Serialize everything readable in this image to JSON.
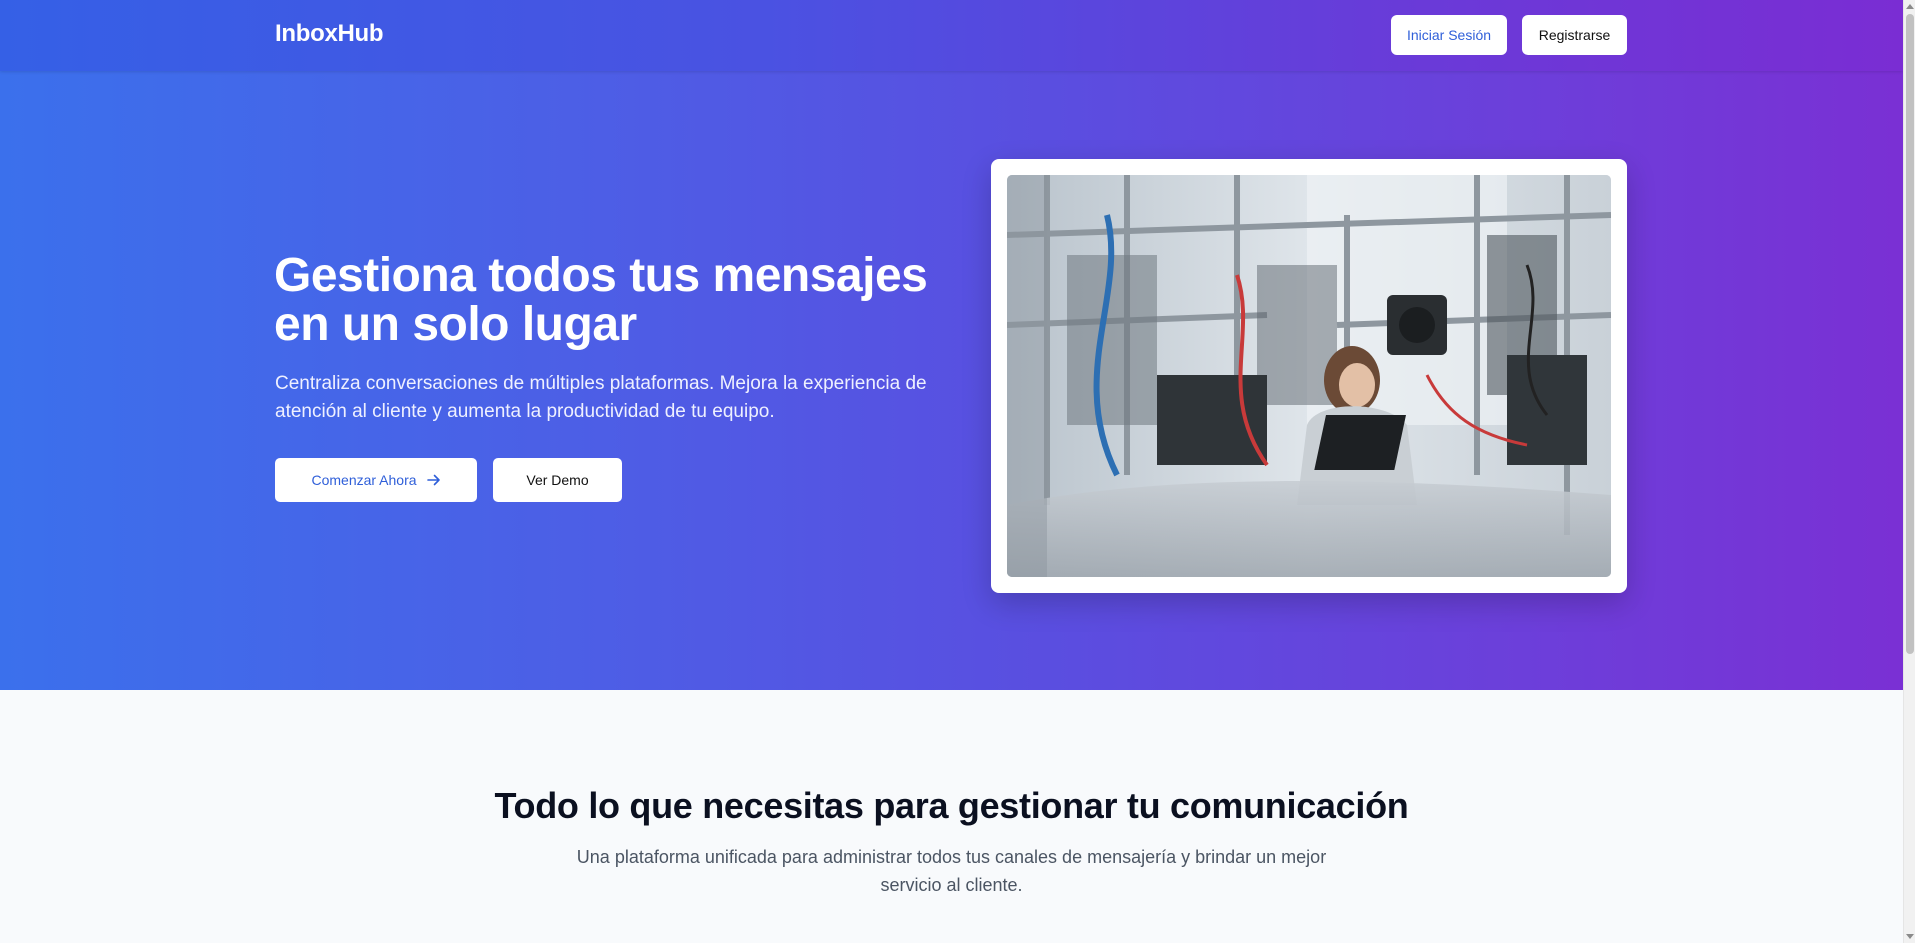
{
  "header": {
    "logo": "InboxHub",
    "login_label": "Iniciar Sesión",
    "register_label": "Registrarse"
  },
  "hero": {
    "title": "Gestiona todos tus mensajes en un solo lugar",
    "subtitle": "Centraliza conversaciones de múltiples plataformas. Mejora la experiencia de atención al cliente y aumenta la productividad de tu equipo.",
    "primary_cta": "Comenzar Ahora",
    "secondary_cta": "Ver Demo",
    "primary_cta_icon": "arrow-right-icon"
  },
  "features": {
    "title": "Todo lo que necesitas para gestionar tu comunicación",
    "subtitle": "Una plataforma unificada para administrar todos tus canales de mensajería y brindar un mejor servicio al cliente."
  },
  "colors": {
    "brand_blue": "#3b70ec",
    "brand_purple": "#7a30d4",
    "link_blue": "#2f5fd9"
  }
}
